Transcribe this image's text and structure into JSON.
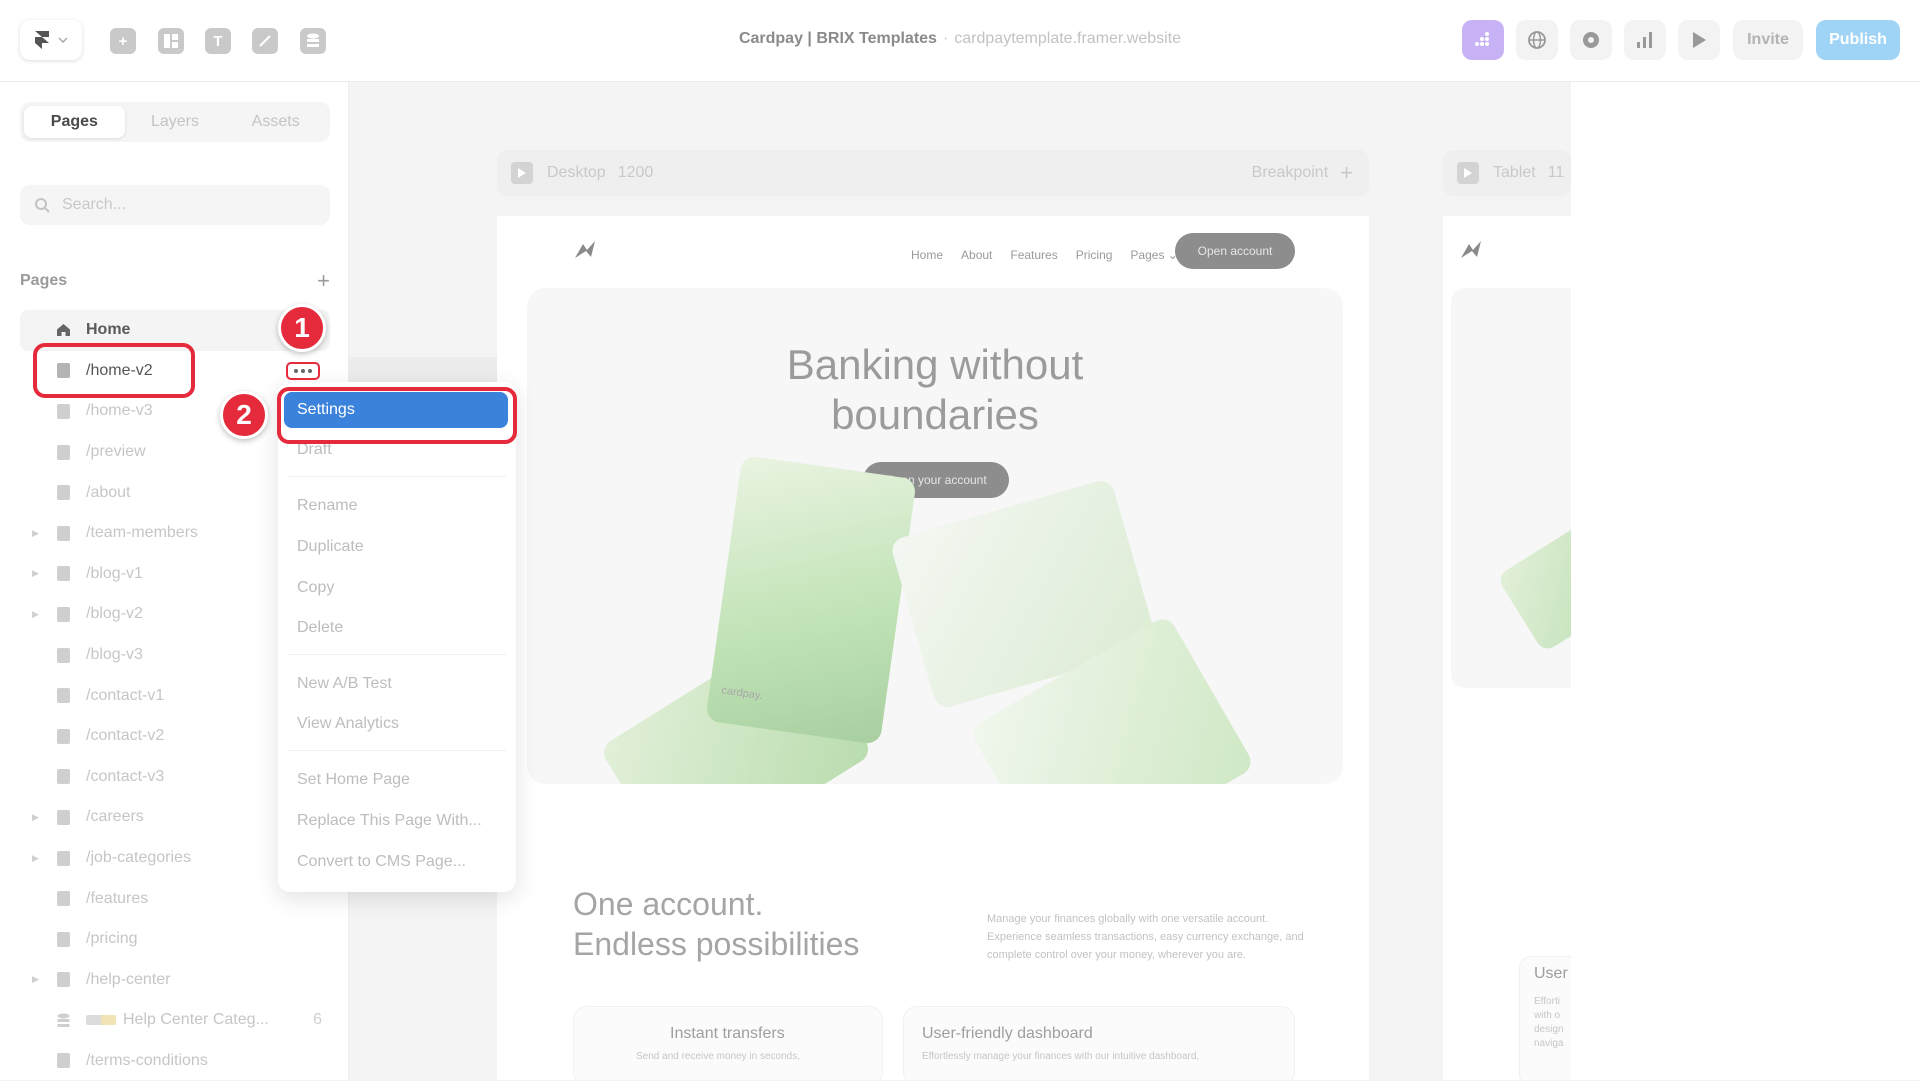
{
  "topbar": {
    "project": "Cardpay | BRIX Templates",
    "separator": "·",
    "url": "cardpaytemplate.framer.website",
    "invite_label": "Invite",
    "publish_label": "Publish",
    "colors": {
      "publish": "#9fd4f6",
      "accent": "#c8b2f6"
    }
  },
  "left_panel": {
    "tabs": [
      {
        "label": "Pages"
      },
      {
        "label": "Layers"
      },
      {
        "label": "Assets"
      }
    ],
    "search": {
      "placeholder": "Search..."
    },
    "section_label": "Pages",
    "pages": [
      {
        "label": "Home"
      },
      {
        "label": "/home-v2"
      },
      {
        "label": "/home-v3"
      },
      {
        "label": "/preview"
      },
      {
        "label": "/about"
      },
      {
        "label": "/team-members"
      },
      {
        "label": "/blog-v1"
      },
      {
        "label": "/blog-v2"
      },
      {
        "label": "/blog-v3"
      },
      {
        "label": "/contact-v1"
      },
      {
        "label": "/contact-v2"
      },
      {
        "label": "/contact-v3"
      },
      {
        "label": "/careers"
      },
      {
        "label": "/job-categories"
      },
      {
        "label": "/features"
      },
      {
        "label": "/pricing"
      },
      {
        "label": "/help-center"
      },
      {
        "label": "Help Center Categ...",
        "count": "6"
      },
      {
        "label": "/terms-conditions"
      }
    ]
  },
  "context_menu": {
    "items": [
      {
        "label": "Settings"
      },
      {
        "label": "Draft"
      },
      {
        "label": "Rename"
      },
      {
        "label": "Duplicate"
      },
      {
        "label": "Copy"
      },
      {
        "label": "Delete"
      },
      {
        "label": "New A/B Test"
      },
      {
        "label": "View Analytics"
      },
      {
        "label": "Set Home Page"
      },
      {
        "label": "Replace This Page With..."
      },
      {
        "label": "Convert to CMS Page..."
      }
    ]
  },
  "annotations": {
    "step1": "1",
    "step2": "2",
    "color": "#e52a3c"
  },
  "canvas": {
    "desktop_frame": {
      "name": "Desktop",
      "size": "1200",
      "breakpoint_label": "Breakpoint"
    },
    "tablet_frame": {
      "name": "Tablet",
      "size": "11"
    },
    "site": {
      "nav": [
        "Home",
        "About",
        "Features",
        "Pricing",
        "Pages"
      ],
      "nav_cta": "Open account",
      "hero_title_line1": "Banking without",
      "hero_title_line2": "boundaries",
      "hero_cta": "Open your account",
      "card_brand": "cardpay.",
      "section_title_line1": "One account.",
      "section_title_line2": "Endless possibilities",
      "section_desc": "Manage your finances globally with one versatile account. Experience seamless transactions, easy currency exchange, and complete control over your money, wherever you are.",
      "feature1_title": "Instant transfers",
      "feature1_desc": "Send and receive money in seconds,",
      "feature2_title": "User-friendly dashboard",
      "feature2_desc": "Effortlessly manage your finances with our intuitive dashboard,",
      "tablet_feature_title": "User",
      "tablet_feature_lines": [
        "Efforti",
        "with o",
        "design",
        "naviga"
      ]
    }
  }
}
